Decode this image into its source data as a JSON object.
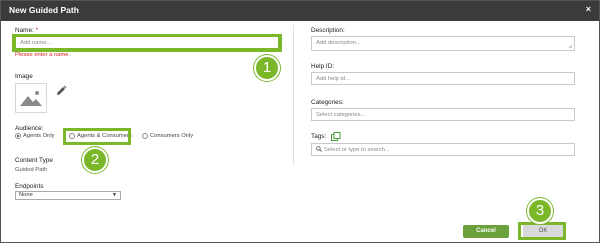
{
  "dialog": {
    "title": "New Guided Path",
    "close": "×"
  },
  "left": {
    "name_label": "Name:",
    "name_required": "*",
    "name_placeholder": "Add name...",
    "name_error": "Please enter a name.",
    "image_label": "Image",
    "audience_label": "Audience:",
    "audience_options": [
      {
        "label": "Agents Only",
        "selected": true
      },
      {
        "label": "Agents & Consumers",
        "selected": false
      },
      {
        "label": "Consumers Only",
        "selected": false
      }
    ],
    "content_type_label": "Content Type",
    "content_type_value": "Guided Path",
    "endpoints_label": "Endpoints",
    "endpoints_value": "None"
  },
  "right": {
    "description_label": "Description:",
    "description_placeholder": "Add description...",
    "help_id_label": "Help ID:",
    "help_id_placeholder": "Add help id...",
    "categories_label": "Categories:",
    "categories_placeholder": "Select categories...",
    "tags_label": "Tags:",
    "tags_placeholder": "Select or type to search..."
  },
  "footer": {
    "cancel": "Cancel",
    "ok": "OK"
  },
  "callouts": [
    "1",
    "2",
    "3"
  ],
  "colors": {
    "titlebar": "#3b3b3b",
    "accent_green": "#7ab82a",
    "cancel_green": "#6aa13c",
    "error_red": "#d81e1e"
  }
}
